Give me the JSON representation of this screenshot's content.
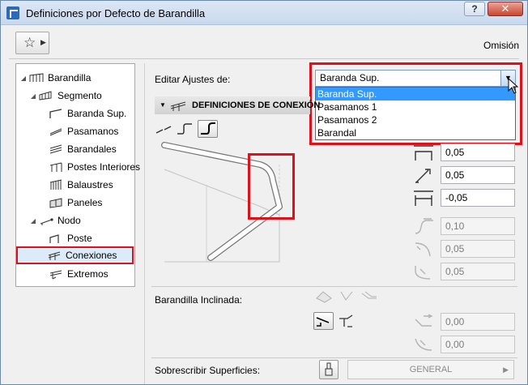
{
  "window": {
    "title": "Definiciones por Defecto de Barandilla",
    "help": "?",
    "close": "✕"
  },
  "toolbar": {
    "favorites_icon": "star-icon",
    "mode_label": "Omisión"
  },
  "tree": {
    "items": [
      {
        "label": "Barandilla",
        "icon": "railing-icon"
      },
      {
        "label": "Segmento",
        "icon": "segment-icon"
      },
      {
        "label": "Baranda Sup.",
        "icon": "top-rail-icon"
      },
      {
        "label": "Pasamanos",
        "icon": "handrail-icon"
      },
      {
        "label": "Barandales",
        "icon": "rails-icon"
      },
      {
        "label": "Postes Interiores",
        "icon": "inner-posts-icon"
      },
      {
        "label": "Balaustres",
        "icon": "balusters-icon"
      },
      {
        "label": "Paneles",
        "icon": "panels-icon"
      },
      {
        "label": "Nodo",
        "icon": "node-icon"
      },
      {
        "label": "Poste",
        "icon": "post-icon"
      },
      {
        "label": "Conexiones",
        "icon": "connections-icon",
        "selected": true
      },
      {
        "label": "Extremos",
        "icon": "ends-icon"
      }
    ]
  },
  "edit_settings": {
    "label": "Editar Ajustes de:",
    "selected": "Baranda Sup.",
    "options": [
      "Baranda Sup.",
      "Pasamanos 1",
      "Pasamanos 2",
      "Barandal"
    ]
  },
  "connections": {
    "header": "DEFINICIONES DE CONEXIÓN",
    "inputs": [
      "0,05",
      "0,05",
      "-0,05"
    ],
    "disabled_inputs": [
      "0,10",
      "0,05",
      "0,05"
    ]
  },
  "inclined": {
    "label": "Barandilla Inclinada:",
    "inputs": [
      "0,00",
      "0,00"
    ]
  },
  "surfaces": {
    "label": "Sobrescribir Superficies:",
    "value": "GENERAL"
  },
  "colors": {
    "highlight": "#3399ff",
    "callout": "#e0101a"
  }
}
